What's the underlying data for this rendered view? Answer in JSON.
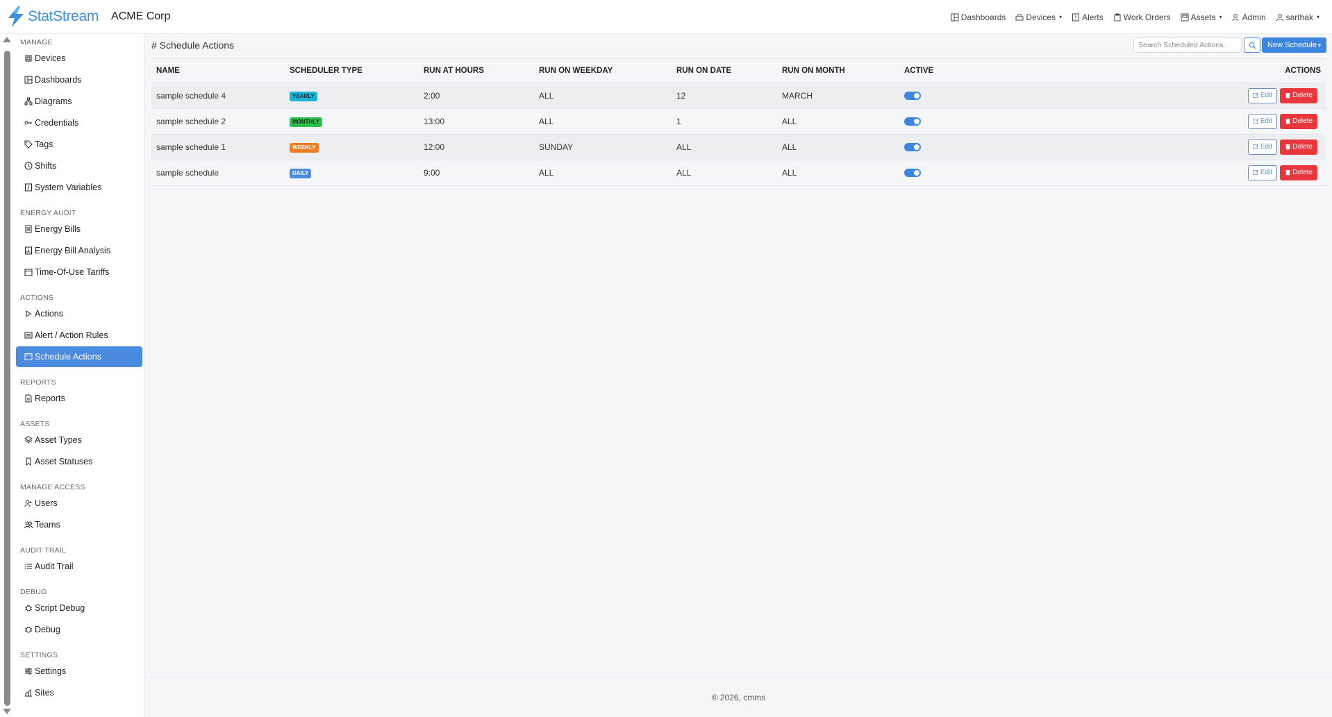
{
  "app": {
    "logo_text": "StatStream",
    "org": "ACME Corp"
  },
  "topnav": [
    {
      "label": "Dashboards",
      "icon": "dashboard-icon",
      "caret": false
    },
    {
      "label": "Devices",
      "icon": "devices-icon",
      "caret": true
    },
    {
      "label": "Alerts",
      "icon": "alert-icon",
      "caret": false
    },
    {
      "label": "Work Orders",
      "icon": "clipboard-icon",
      "caret": false
    },
    {
      "label": "Assets",
      "icon": "assets-icon",
      "caret": true
    },
    {
      "label": "Admin",
      "icon": "admin-icon",
      "caret": false
    },
    {
      "label": "sarthak",
      "icon": "user-icon",
      "caret": true
    }
  ],
  "sidebar": {
    "sections": [
      {
        "title": "MANAGE",
        "items": [
          "Devices",
          "Dashboards",
          "Diagrams",
          "Credentials",
          "Tags",
          "Shifts",
          "System Variables"
        ]
      },
      {
        "title": "ENERGY AUDIT",
        "items": [
          "Energy Bills",
          "Energy Bill Analysis",
          "Time-Of-Use Tariffs"
        ]
      },
      {
        "title": "ACTIONS",
        "items": [
          "Actions",
          "Alert / Action Rules",
          "Schedule Actions"
        ]
      },
      {
        "title": "REPORTS",
        "items": [
          "Reports"
        ]
      },
      {
        "title": "ASSETS",
        "items": [
          "Asset Types",
          "Asset Statuses"
        ]
      },
      {
        "title": "MANAGE ACCESS",
        "items": [
          "Users",
          "Teams"
        ]
      },
      {
        "title": "AUDIT TRAIL",
        "items": [
          "Audit Trail"
        ]
      },
      {
        "title": "DEBUG",
        "items": [
          "Script Debug",
          "Debug"
        ]
      },
      {
        "title": "SETTINGS",
        "items": [
          "Settings",
          "Sites"
        ]
      }
    ],
    "active_item": "Schedule Actions"
  },
  "page": {
    "title": "# Schedule Actions",
    "search_placeholder": "Search Scheduled Actions.",
    "new_button": "New Schedule"
  },
  "table": {
    "columns": [
      "NAME",
      "SCHEDULER TYPE",
      "RUN AT HOURS",
      "RUN ON WEEKDAY",
      "RUN ON DATE",
      "RUN ON MONTH",
      "ACTIVE",
      "ACTIONS"
    ],
    "rows": [
      {
        "name": "sample schedule 4",
        "type": "YEARLY",
        "hours": "2:00",
        "weekday": "ALL",
        "date": "12",
        "month": "MARCH",
        "active": true
      },
      {
        "name": "sample schedule 2",
        "type": "MONTHLY",
        "hours": "13:00",
        "weekday": "ALL",
        "date": "1",
        "month": "ALL",
        "active": true
      },
      {
        "name": "sample schedule 1",
        "type": "WEEKLY",
        "hours": "12:00",
        "weekday": "SUNDAY",
        "date": "ALL",
        "month": "ALL",
        "active": true
      },
      {
        "name": "sample schedule",
        "type": "DAILY",
        "hours": "9:00",
        "weekday": "ALL",
        "date": "ALL",
        "month": "ALL",
        "active": true
      }
    ],
    "edit_label": "Edit",
    "delete_label": "Delete"
  },
  "badge_colors": {
    "YEARLY": {
      "bg": "#17b4d6",
      "fg": "#0b2b33"
    },
    "MONTHLY": {
      "bg": "#2fbf4f",
      "fg": "#0c2e14"
    },
    "WEEKLY": {
      "bg": "#f07d22",
      "fg": "#ffffff"
    },
    "DAILY": {
      "bg": "#4a8be0",
      "fg": "#ffffff"
    }
  },
  "footer": "© 2026, cmms",
  "colors": {
    "accent": "#3d86e0",
    "danger": "#e8383d"
  }
}
